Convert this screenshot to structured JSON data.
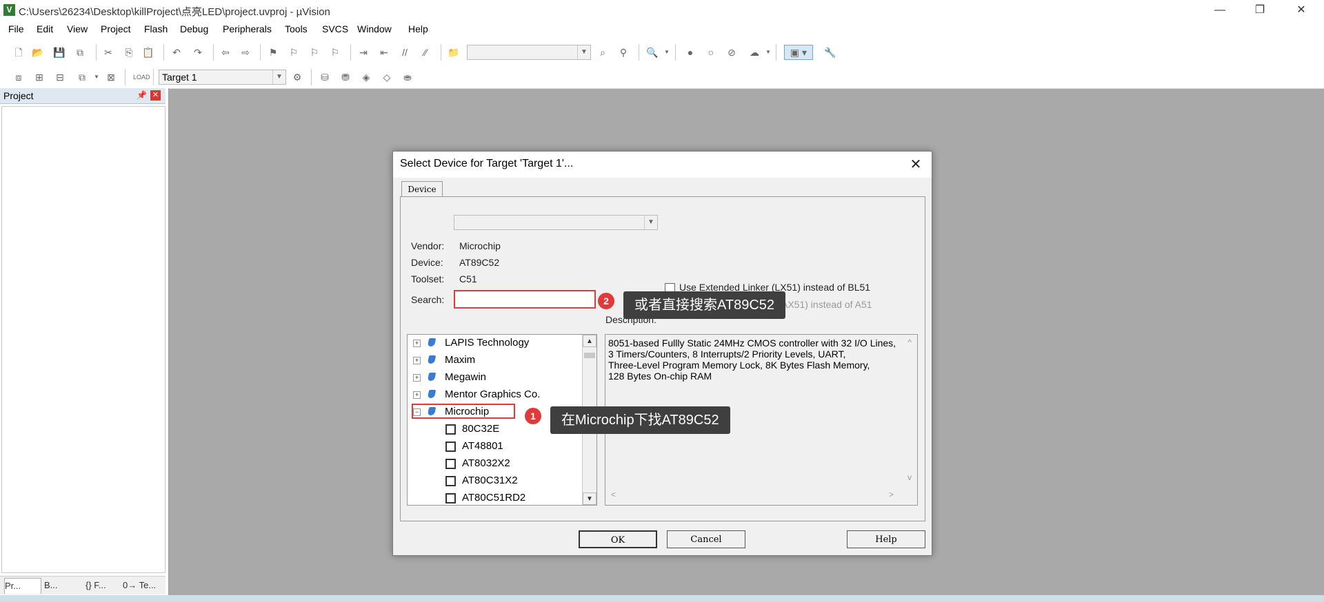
{
  "window": {
    "app_icon": "V",
    "title": "C:\\Users\\26234\\Desktop\\killProject\\点亮LED\\project.uvproj - µVision",
    "controls": {
      "minimize": "—",
      "restore": "❐",
      "close": "✕"
    }
  },
  "menu": [
    "File",
    "Edit",
    "View",
    "Project",
    "Flash",
    "Debug",
    "Peripherals",
    "Tools",
    "SVCS",
    "Window",
    "Help"
  ],
  "toolbar2": {
    "target_combo": "Target 1"
  },
  "project_panel": {
    "title": "Project",
    "tabs": [
      "Pr...",
      "B...",
      "{} F...",
      "0→ Te..."
    ]
  },
  "dialog": {
    "title": "Select Device for Target 'Target 1'...",
    "tab": "Device",
    "labels": {
      "vendor": "Vendor:",
      "device": "Device:",
      "toolset": "Toolset:",
      "search": "Search:",
      "description": "Description:"
    },
    "values": {
      "vendor": "Microchip",
      "device": "AT89C52",
      "toolset": "C51"
    },
    "search_value": "",
    "options": [
      {
        "label": "Use Extended Linker (LX51) instead of BL51",
        "checked": false
      },
      {
        "label": "AX51) instead of A51",
        "checked": false
      }
    ],
    "tree": {
      "vendors": [
        "LAPIS Technology",
        "Maxim",
        "Megawin",
        "Mentor Graphics Co.",
        "Microchip"
      ],
      "devices": [
        "80C32E",
        "AT48801",
        "AT8032X2",
        "AT80C31X2",
        "AT80C51RD2"
      ]
    },
    "description": "8051-based Fullly Static 24MHz CMOS controller with 32  I/O Lines,\n3 Timers/Counters, 8 Interrupts/2 Priority Levels, UART,\nThree-Level Program Memory Lock, 8K Bytes Flash Memory,\n128 Bytes On-chip RAM",
    "buttons": {
      "ok": "OK",
      "cancel": "Cancel",
      "help": "Help"
    }
  },
  "annotations": {
    "step1": {
      "number": "1",
      "text": "在Microchip下找AT89C52"
    },
    "step2": {
      "number": "2",
      "text": "或者直接搜索AT89C52"
    }
  }
}
